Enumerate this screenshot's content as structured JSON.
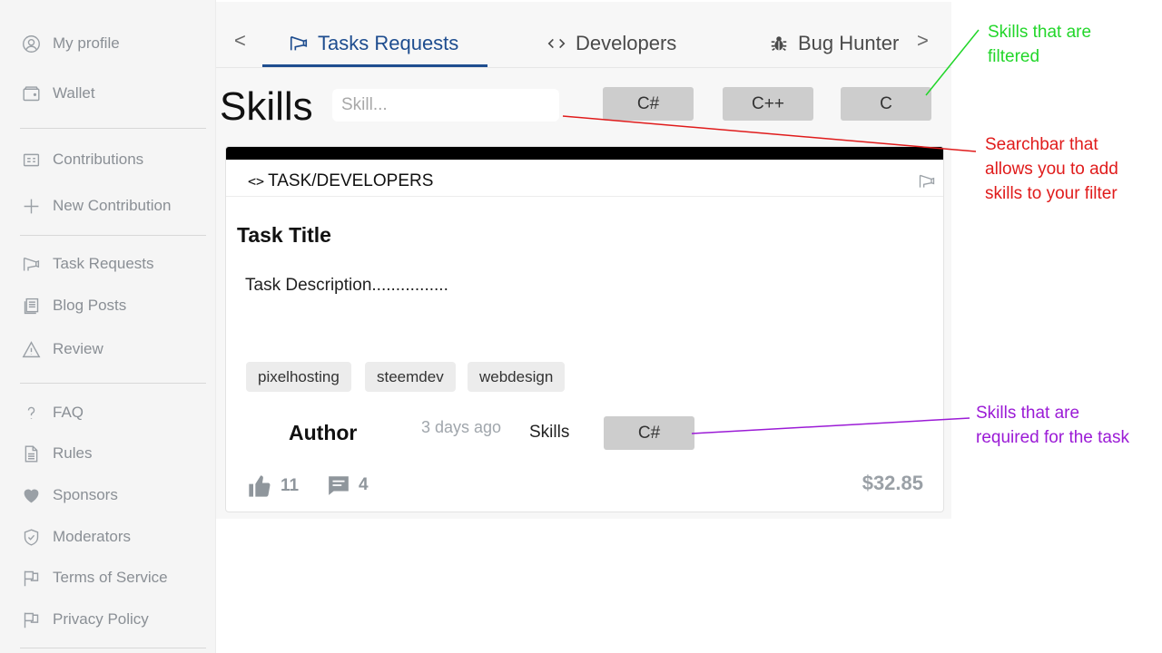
{
  "sidebar": {
    "items": [
      {
        "label": "My profile",
        "icon": "user-circle-icon"
      },
      {
        "label": "Wallet",
        "icon": "wallet-icon"
      },
      {
        "label": "Contributions",
        "icon": "contributions-icon"
      },
      {
        "label": "New Contribution",
        "icon": "plus-icon"
      },
      {
        "label": "Task Requests",
        "icon": "megaphone-icon"
      },
      {
        "label": "Blog Posts",
        "icon": "blog-icon"
      },
      {
        "label": "Review",
        "icon": "warning-icon"
      },
      {
        "label": "FAQ",
        "icon": "question-icon"
      },
      {
        "label": "Rules",
        "icon": "document-icon"
      },
      {
        "label": "Sponsors",
        "icon": "heart-icon"
      },
      {
        "label": "Moderators",
        "icon": "shield-icon"
      },
      {
        "label": "Terms of Service",
        "icon": "flag-icon"
      },
      {
        "label": "Privacy Policy",
        "icon": "flag-icon"
      }
    ]
  },
  "tabs": {
    "prev": "<",
    "next": ">",
    "items": [
      {
        "label": "Tasks Requests",
        "icon": "megaphone-icon",
        "active": true
      },
      {
        "label": "Developers",
        "icon": "code-icon",
        "active": false
      },
      {
        "label": "Bug Hunter",
        "icon": "bug-icon",
        "active": false
      }
    ],
    "active_color": "#1e4d8f"
  },
  "filter": {
    "heading": "Skills",
    "placeholder": "Skill...",
    "chips": [
      "C#",
      "C++",
      "C"
    ]
  },
  "card": {
    "category": "TASK/DEVELOPERS",
    "category_icon": "<>",
    "title": "Task Title",
    "description": "Task Description................",
    "tags": [
      "pixelhosting",
      "steemdev",
      "webdesign"
    ],
    "author": "Author",
    "time": "3 days ago",
    "skills_label": "Skills",
    "required_skills": [
      "C#"
    ],
    "likes": "11",
    "comments": "4",
    "payout": "$32.85"
  },
  "annotations": {
    "filtered": {
      "lines": [
        "Skills that are",
        "filtered"
      ],
      "color": "#22d62a"
    },
    "searchbar": {
      "lines": [
        "Searchbar that",
        "allows you to add",
        "skills to your filter"
      ],
      "color": "#e01b1b"
    },
    "required": {
      "lines": [
        "Skills that are",
        "required for the task"
      ],
      "color": "#9b1bd6"
    }
  }
}
